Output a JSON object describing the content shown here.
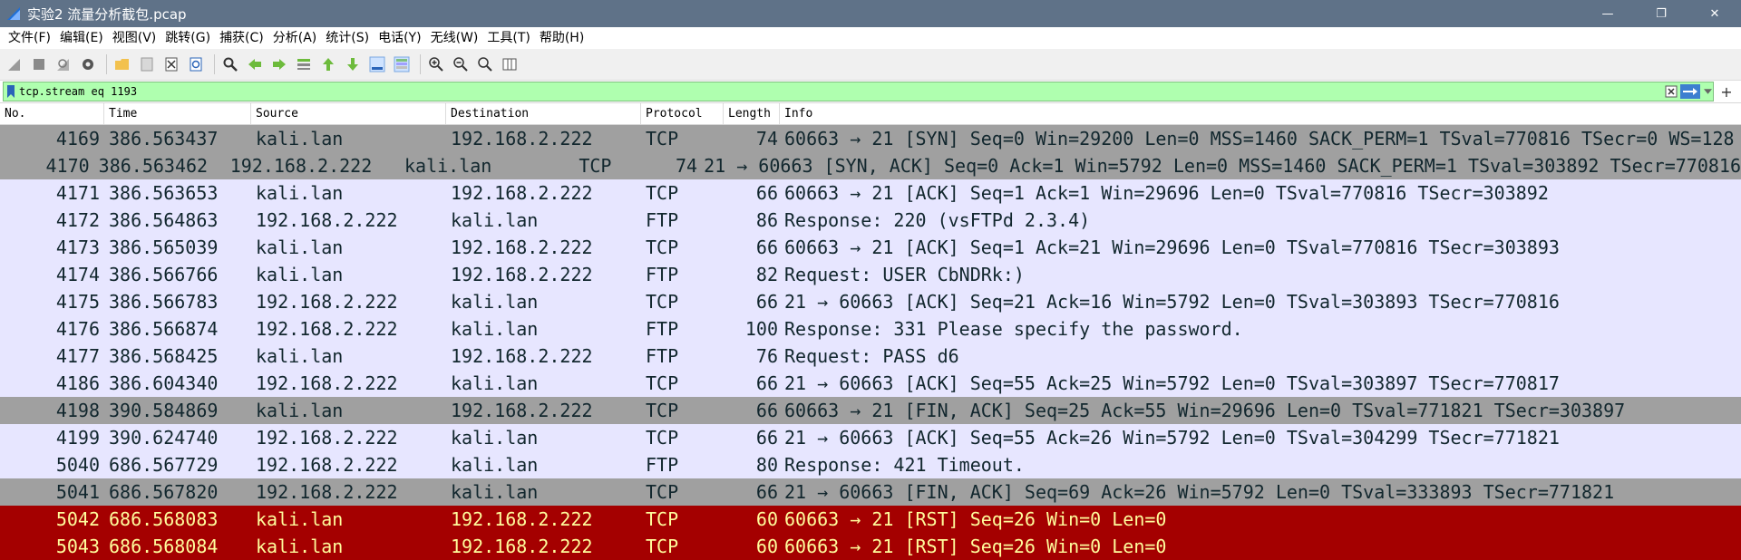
{
  "window": {
    "title": "实验2 流量分析截包.pcap",
    "min_glyph": "—",
    "max_glyph": "❐",
    "close_glyph": "✕"
  },
  "menu": [
    "文件(F)",
    "编辑(E)",
    "视图(V)",
    "跳转(G)",
    "捕获(C)",
    "分析(A)",
    "统计(S)",
    "电话(Y)",
    "无线(W)",
    "工具(T)",
    "帮助(H)"
  ],
  "filter": {
    "value": "tcp.stream eq 1193",
    "plus": "+"
  },
  "columns": {
    "no": "No.",
    "time": "Time",
    "source": "Source",
    "destination": "Destination",
    "protocol": "Protocol",
    "length": "Length",
    "info": "Info"
  },
  "packets": [
    {
      "no": "4169",
      "time": "386.563437",
      "source": "kali.lan",
      "destination": "192.168.2.222",
      "protocol": "TCP",
      "length": "74",
      "info": "60663 → 21 [SYN] Seq=0 Win=29200 Len=0 MSS=1460 SACK_PERM=1 TSval=770816 TSecr=0 WS=128",
      "style": "synfin"
    },
    {
      "no": "4170",
      "time": "386.563462",
      "source": "192.168.2.222",
      "destination": "kali.lan",
      "protocol": "TCP",
      "length": "74",
      "info": "21 → 60663 [SYN, ACK] Seq=0 Ack=1 Win=5792 Len=0 MSS=1460 SACK_PERM=1 TSval=303892 TSecr=770816",
      "style": "synfin"
    },
    {
      "no": "4171",
      "time": "386.563653",
      "source": "kali.lan",
      "destination": "192.168.2.222",
      "protocol": "TCP",
      "length": "66",
      "info": "60663 → 21 [ACK] Seq=1 Ack=1 Win=29696 Len=0 TSval=770816 TSecr=303892",
      "style": "tcp-normal"
    },
    {
      "no": "4172",
      "time": "386.564863",
      "source": "192.168.2.222",
      "destination": "kali.lan",
      "protocol": "FTP",
      "length": "86",
      "info": "Response: 220 (vsFTPd 2.3.4)",
      "style": "ftp"
    },
    {
      "no": "4173",
      "time": "386.565039",
      "source": "kali.lan",
      "destination": "192.168.2.222",
      "protocol": "TCP",
      "length": "66",
      "info": "60663 → 21 [ACK] Seq=1 Ack=21 Win=29696 Len=0 TSval=770816 TSecr=303893",
      "style": "tcp-normal"
    },
    {
      "no": "4174",
      "time": "386.566766",
      "source": "kali.lan",
      "destination": "192.168.2.222",
      "protocol": "FTP",
      "length": "82",
      "info": "Request: USER CbNDRk:)",
      "style": "ftp"
    },
    {
      "no": "4175",
      "time": "386.566783",
      "source": "192.168.2.222",
      "destination": "kali.lan",
      "protocol": "TCP",
      "length": "66",
      "info": "21 → 60663 [ACK] Seq=21 Ack=16 Win=5792 Len=0 TSval=303893 TSecr=770816",
      "style": "tcp-normal"
    },
    {
      "no": "4176",
      "time": "386.566874",
      "source": "192.168.2.222",
      "destination": "kali.lan",
      "protocol": "FTP",
      "length": "100",
      "info": "Response: 331 Please specify the password.",
      "style": "ftp"
    },
    {
      "no": "4177",
      "time": "386.568425",
      "source": "kali.lan",
      "destination": "192.168.2.222",
      "protocol": "FTP",
      "length": "76",
      "info": "Request: PASS d6",
      "style": "ftp"
    },
    {
      "no": "4186",
      "time": "386.604340",
      "source": "192.168.2.222",
      "destination": "kali.lan",
      "protocol": "TCP",
      "length": "66",
      "info": "21 → 60663 [ACK] Seq=55 Ack=25 Win=5792 Len=0 TSval=303897 TSecr=770817",
      "style": "tcp-normal"
    },
    {
      "no": "4198",
      "time": "390.584869",
      "source": "kali.lan",
      "destination": "192.168.2.222",
      "protocol": "TCP",
      "length": "66",
      "info": "60663 → 21 [FIN, ACK] Seq=25 Ack=55 Win=29696 Len=0 TSval=771821 TSecr=303897",
      "style": "synfin"
    },
    {
      "no": "4199",
      "time": "390.624740",
      "source": "192.168.2.222",
      "destination": "kali.lan",
      "protocol": "TCP",
      "length": "66",
      "info": "21 → 60663 [ACK] Seq=55 Ack=26 Win=5792 Len=0 TSval=304299 TSecr=771821",
      "style": "tcp-normal"
    },
    {
      "no": "5040",
      "time": "686.567729",
      "source": "192.168.2.222",
      "destination": "kali.lan",
      "protocol": "FTP",
      "length": "80",
      "info": "Response: 421 Timeout.",
      "style": "ftp"
    },
    {
      "no": "5041",
      "time": "686.567820",
      "source": "192.168.2.222",
      "destination": "kali.lan",
      "protocol": "TCP",
      "length": "66",
      "info": "21 → 60663 [FIN, ACK] Seq=69 Ack=26 Win=5792 Len=0 TSval=333893 TSecr=771821",
      "style": "synfin"
    },
    {
      "no": "5042",
      "time": "686.568083",
      "source": "kali.lan",
      "destination": "192.168.2.222",
      "protocol": "TCP",
      "length": "60",
      "info": "60663 → 21 [RST] Seq=26 Win=0 Len=0",
      "style": "rst"
    },
    {
      "no": "5043",
      "time": "686.568084",
      "source": "kali.lan",
      "destination": "192.168.2.222",
      "protocol": "TCP",
      "length": "60",
      "info": "60663 → 21 [RST] Seq=26 Win=0 Len=0",
      "style": "rst"
    }
  ]
}
